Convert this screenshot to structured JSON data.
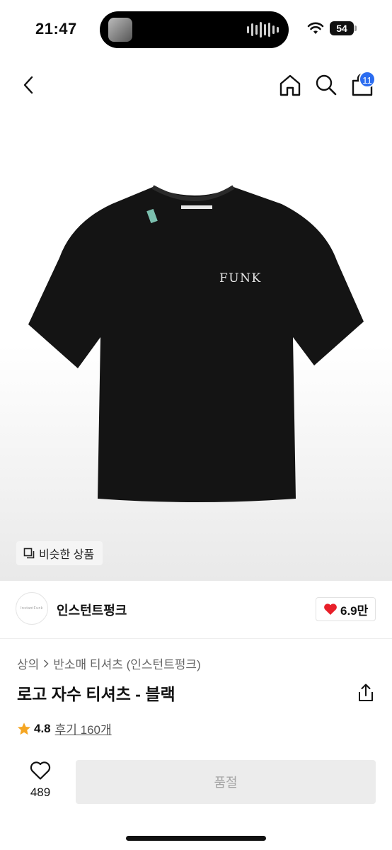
{
  "status": {
    "time": "21:47",
    "battery": "54"
  },
  "nav": {
    "cart_count": "11"
  },
  "product_image": {
    "print_text": "FUNK"
  },
  "similar_button": "비슷한 상품",
  "brand": {
    "logo_text": "InstantFunk",
    "name": "인스턴트펑크",
    "likes": "6.9만"
  },
  "breadcrumb": {
    "category": "상의",
    "subcategory": "반소매 티셔츠 (인스턴트펑크)"
  },
  "product": {
    "title": "로고 자수 티셔츠 - 블랙",
    "rating": "4.8",
    "reviews": "후기 160개"
  },
  "bottom": {
    "wish_count": "489",
    "action_label": "품절"
  },
  "colors": {
    "accent_blue": "#2b6cf0",
    "heart_red": "#e8202a",
    "star_orange": "#f5a623"
  }
}
